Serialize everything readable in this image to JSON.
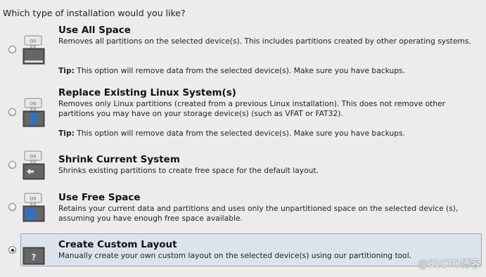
{
  "question": "Which type of installation would you like?",
  "options": [
    {
      "title": "Use All Space",
      "description": "Removes all partitions on the selected device(s).  This includes partitions created by other operating systems.",
      "tip_label": "Tip:",
      "tip_text": "This option will remove data from the selected device(s).  Make sure you have backups.",
      "icon": "disk-all-space-icon",
      "selected": false
    },
    {
      "title": "Replace Existing Linux System(s)",
      "description": "Removes only Linux partitions (created from a previous Linux installation).  This does not remove other partitions you may have on your storage device(s) (such as VFAT or FAT32).",
      "tip_label": "Tip:",
      "tip_text": "This option will remove data from the selected device(s).  Make sure you have backups.",
      "icon": "disk-replace-linux-icon",
      "selected": false
    },
    {
      "title": "Shrink Current System",
      "description": "Shrinks existing partitions to create free space for the default layout.",
      "icon": "disk-shrink-icon",
      "selected": false
    },
    {
      "title": "Use Free Space",
      "description": "Retains your current data and partitions and uses only the unpartitioned space on the selected device (s), assuming you have enough free space available.",
      "icon": "disk-free-space-icon",
      "selected": false
    },
    {
      "title": "Create Custom Layout",
      "description": "Manually create your own custom layout on the selected device(s) using our partitioning tool.",
      "icon": "disk-custom-layout-icon",
      "selected": true
    }
  ],
  "icon_os_label": "OS",
  "icon_question_label": "?",
  "watermark": "@51CTO博客",
  "colors": {
    "selected_row": "#dde3ec",
    "disk_blue": "#3a6fb8"
  }
}
